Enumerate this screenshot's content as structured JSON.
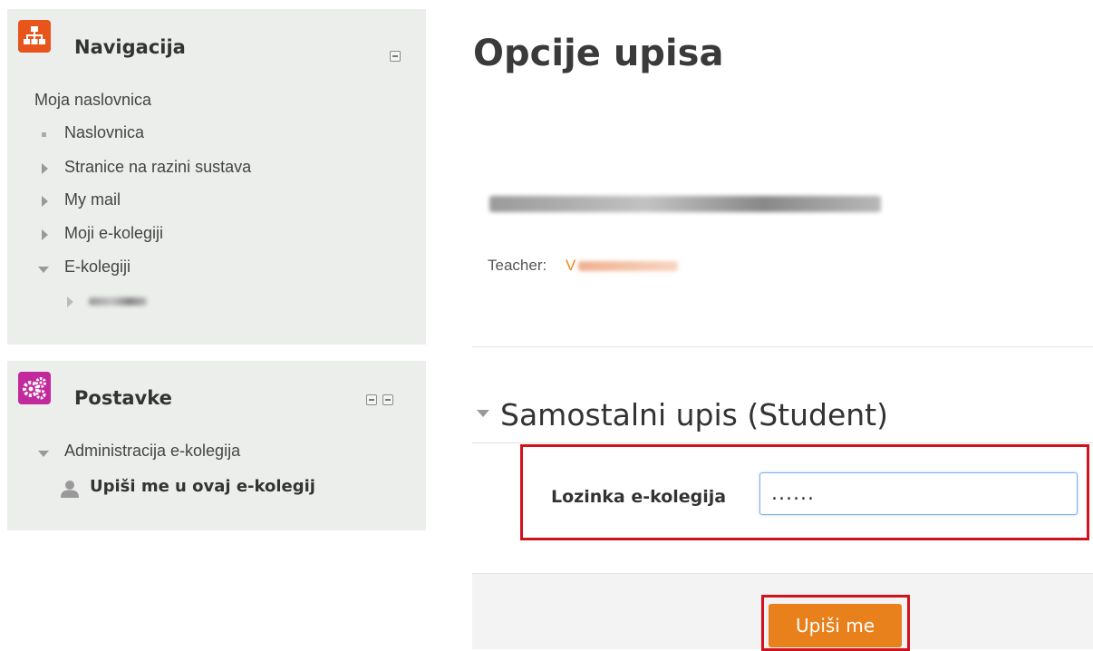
{
  "navigation": {
    "title": "Navigacija",
    "icon": "sitemap-icon",
    "icon_color": "#e8551c",
    "home_label": "Moja naslovnica",
    "items": [
      {
        "label": "Naslovnica",
        "marker": "square-bullet"
      },
      {
        "label": "Stranice na razini sustava",
        "marker": "collapsed-arrow"
      },
      {
        "label": "My mail",
        "marker": "collapsed-arrow"
      },
      {
        "label": "Moji e-kolegiji",
        "marker": "collapsed-arrow"
      },
      {
        "label": "E-kolegiji",
        "marker": "expanded-arrow"
      }
    ]
  },
  "settings": {
    "title": "Postavke",
    "icon": "gears-icon",
    "icon_color": "#c2299c",
    "admin_label": "Administracija e-kolegija",
    "enrol_link": "Upiši me u ovaj e-kolegij"
  },
  "main": {
    "page_title": "Opcije upisa",
    "teacher_label": "Teacher: ",
    "teacher_initial": "V",
    "section_title": "Samostalni upis (Student)",
    "password_label": "Lozinka e-kolegija",
    "password_value": "......",
    "submit_label": "Upiši me"
  },
  "colors": {
    "accent": "#f98012",
    "button": "#e8801c",
    "highlight": "#d0121d"
  }
}
